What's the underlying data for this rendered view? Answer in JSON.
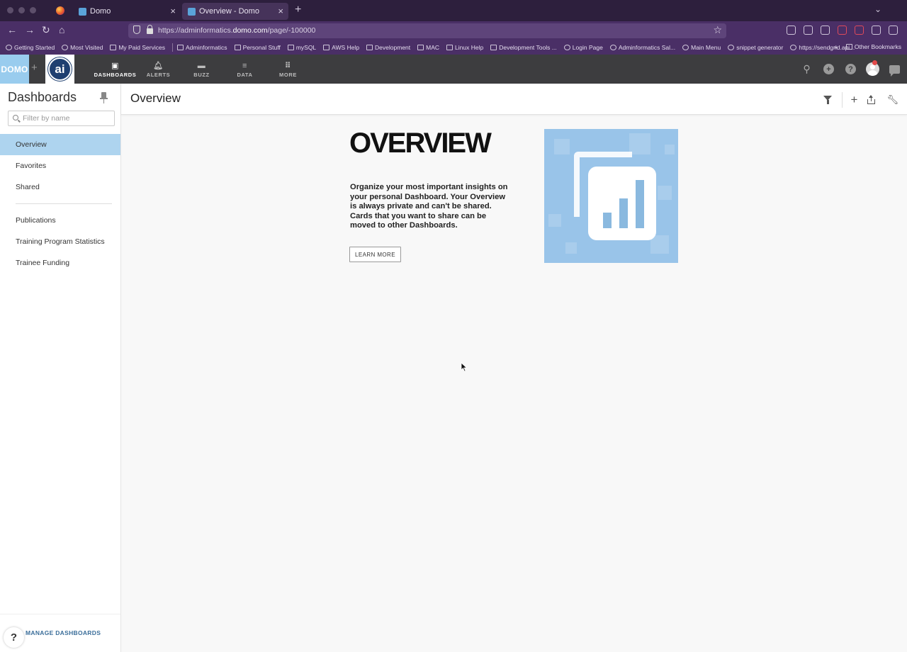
{
  "browser": {
    "tabs": [
      {
        "title": "Domo"
      },
      {
        "title": "Overview - Domo"
      }
    ],
    "url_prefix": "https://adminformatics.",
    "url_domain": "domo.com",
    "url_path": "/page/-100000",
    "bookmarks": [
      "Getting Started",
      "Most Visited",
      "My Paid Services",
      "Adminformatics",
      "Personal Stuff",
      "mySQL",
      "AWS Help",
      "Development",
      "MAC",
      "Linux Help",
      "Development Tools ...",
      "Login Page",
      "Adminformatics Sal...",
      "Main Menu",
      "snippet generator",
      "https://sendgrid.api..."
    ],
    "other_bookmarks": "Other Bookmarks"
  },
  "domo": {
    "logo_text": "DOMO",
    "ai_text": "ai",
    "nav": [
      {
        "label": "DASHBOARDS",
        "icon": "dashboards-icon"
      },
      {
        "label": "ALERTS",
        "icon": "bell-icon"
      },
      {
        "label": "BUZZ",
        "icon": "chat-icon"
      },
      {
        "label": "DATA",
        "icon": "database-icon"
      },
      {
        "label": "MORE",
        "icon": "grid-icon"
      }
    ]
  },
  "sidebar": {
    "title": "Dashboards",
    "filter_placeholder": "Filter by name",
    "items_top": [
      "Overview",
      "Favorites",
      "Shared"
    ],
    "items_bottom": [
      "Publications",
      "Training Program Statistics",
      "Trainee Funding"
    ],
    "manage_label": "MANAGE DASHBOARDS",
    "help_label": "?"
  },
  "page": {
    "title": "Overview"
  },
  "overview": {
    "heading": "OVERVIEW",
    "description": "Organize your most important insights on your personal Dashboard. Your Overview is always private and can't be shared. Cards that you want to share can be moved to other Dashboards.",
    "learn_more": "LEARN MORE"
  },
  "colors": {
    "browser_tabbar": "#2d1f3d",
    "browser_toolbar": "#4a2f66",
    "domo_header": "#3d3d3f",
    "domo_logo": "#99ccee",
    "sidebar_active": "#aed4ef",
    "overview_image": "#99c4e9"
  }
}
